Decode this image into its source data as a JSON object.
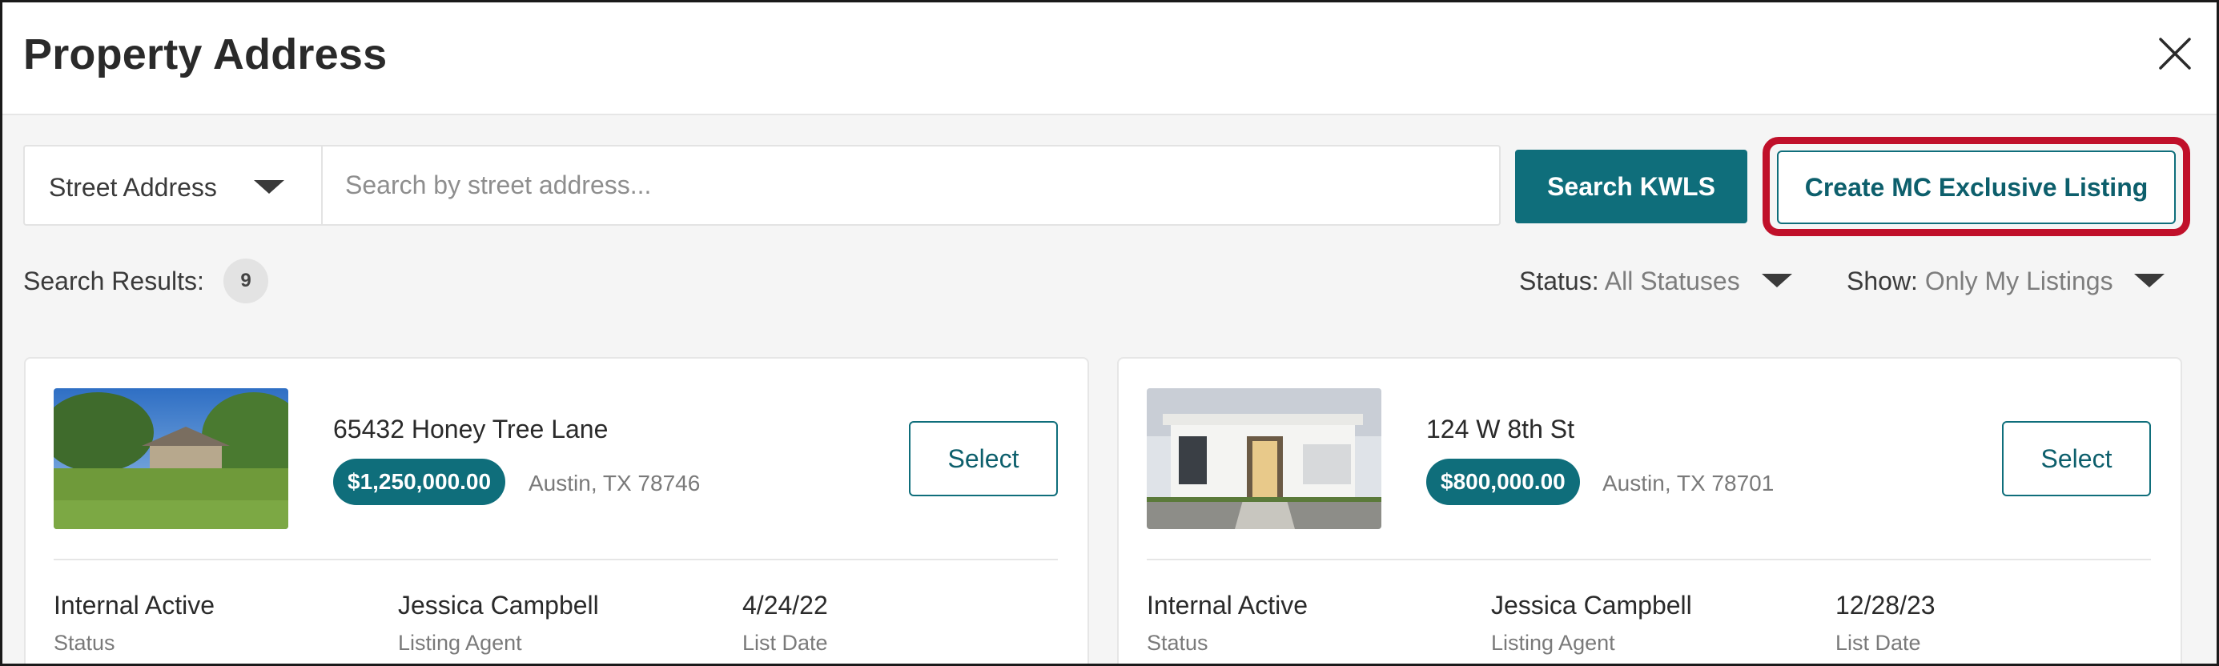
{
  "dialog": {
    "title": "Property Address",
    "close_icon": "close-icon"
  },
  "search": {
    "address_type": "Street Address",
    "placeholder": "Search by street address...",
    "search_button": "Search KWLS",
    "create_button": "Create MC Exclusive Listing",
    "highlight_color": "#c0102a"
  },
  "results": {
    "label": "Search Results:",
    "count": "9",
    "status_filter": {
      "label": "Status:",
      "value": "All Statuses"
    },
    "show_filter": {
      "label": "Show:",
      "value": "Only My Listings"
    }
  },
  "colors": {
    "brand_teal": "#0f6e7b",
    "background": "#f5f5f5"
  },
  "listings": [
    {
      "street": "65432 Honey Tree Lane",
      "price": "$1,250,000.00",
      "city": "Austin, TX 78746",
      "select_label": "Select",
      "status_value": "Internal Active",
      "status_label": "Status",
      "agent_value": "Jessica Campbell",
      "agent_label": "Listing Agent",
      "date_value": "4/24/22",
      "date_label": "List Date"
    },
    {
      "street": "124 W 8th St",
      "price": "$800,000.00",
      "city": "Austin, TX 78701",
      "select_label": "Select",
      "status_value": "Internal Active",
      "status_label": "Status",
      "agent_value": "Jessica Campbell",
      "agent_label": "Listing Agent",
      "date_value": "12/28/23",
      "date_label": "List Date"
    }
  ]
}
